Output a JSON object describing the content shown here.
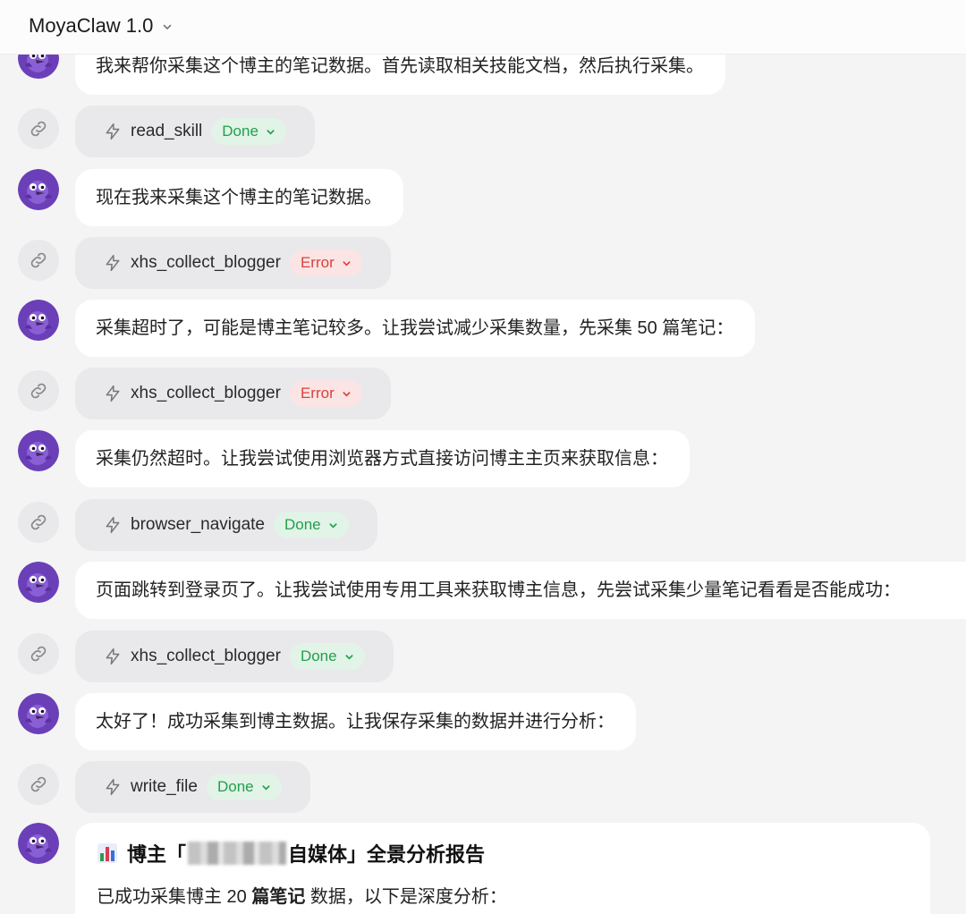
{
  "header": {
    "app_title": "MoyaClaw 1.0"
  },
  "messages": [
    {
      "kind": "assistant",
      "text": "我来帮你采集这个博主的笔记数据。首先读取相关技能文档，然后执行采集。"
    },
    {
      "kind": "tool",
      "name": "read_skill",
      "status": "Done"
    },
    {
      "kind": "assistant",
      "text": "现在我来采集这个博主的笔记数据。"
    },
    {
      "kind": "tool",
      "name": "xhs_collect_blogger",
      "status": "Error"
    },
    {
      "kind": "assistant",
      "text": "采集超时了，可能是博主笔记较多。让我尝试减少采集数量，先采集 50 篇笔记："
    },
    {
      "kind": "tool",
      "name": "xhs_collect_blogger",
      "status": "Error"
    },
    {
      "kind": "assistant",
      "text": "采集仍然超时。让我尝试使用浏览器方式直接访问博主主页来获取信息："
    },
    {
      "kind": "tool",
      "name": "browser_navigate",
      "status": "Done"
    },
    {
      "kind": "assistant",
      "text": "页面跳转到登录页了。让我尝试使用专用工具来获取博主信息，先尝试采集少量笔记看看是否能成功："
    },
    {
      "kind": "tool",
      "name": "xhs_collect_blogger",
      "status": "Done"
    },
    {
      "kind": "assistant",
      "text": "太好了！成功采集到博主数据。让我保存采集的数据并进行分析："
    },
    {
      "kind": "tool",
      "name": "write_file",
      "status": "Done"
    }
  ],
  "report": {
    "icon": "bar-chart-icon",
    "title_prefix": "博主「",
    "title_suffix": "自媒体」全景分析报告",
    "line_before": "已成功采集博主 20 ",
    "line_bold": "篇笔记",
    "line_after": " 数据，以下是深度分析："
  },
  "colors": {
    "done_text": "#22a04d",
    "done_bg": "#e2f3e7",
    "error_text": "#d9423d",
    "error_bg": "#fbe4e4",
    "avatar": "#6b3fb8"
  }
}
